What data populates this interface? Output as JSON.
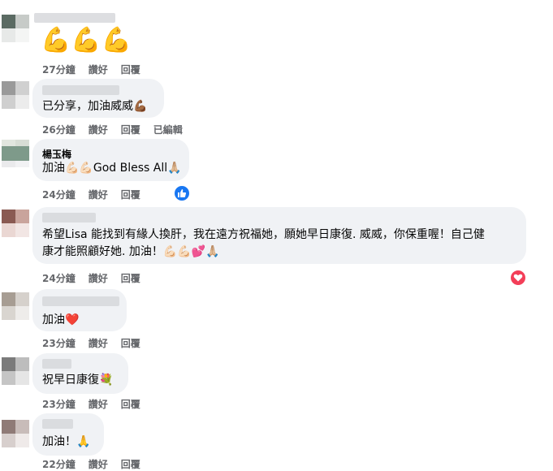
{
  "comments": [
    {
      "text": "💪💪💪",
      "time": "27分鐘",
      "like": "讚好",
      "reply": "回覆"
    },
    {
      "text": "已分享，加油威威💪🏾",
      "time": "26分鐘",
      "like": "讚好",
      "reply": "回覆",
      "edited": "已編輯"
    },
    {
      "name": "楊玉梅",
      "text": "加油💪🏻💪🏻God Bless All🙏🏼",
      "time": "24分鐘",
      "like": "讚好",
      "reply": "回覆"
    },
    {
      "text_line1": "希望Lisa 能找到有緣人換肝，我在遠方祝福她，願她早日康復. 威威，你保重喔！自己健",
      "text_line2": "康才能照顧好她. 加油！💪🏻💪🏻💕🙏🏼",
      "time": "24分鐘",
      "like": "讚好",
      "reply": "回覆"
    },
    {
      "text": "加油❤️",
      "time": "23分鐘",
      "like": "讚好",
      "reply": "回覆"
    },
    {
      "text": "祝早日康復💐",
      "time": "23分鐘",
      "like": "讚好",
      "reply": "回覆"
    },
    {
      "text": "加油！🙏",
      "time": "22分鐘",
      "like": "讚好",
      "reply": "回覆"
    }
  ],
  "colors": {
    "bubble": "#f0f2f5",
    "meta": "#65676b",
    "like_blue": "#1877f2",
    "love_red": "#f33e58"
  },
  "icons": [
    "like-reaction-icon",
    "love-reaction-icon"
  ]
}
